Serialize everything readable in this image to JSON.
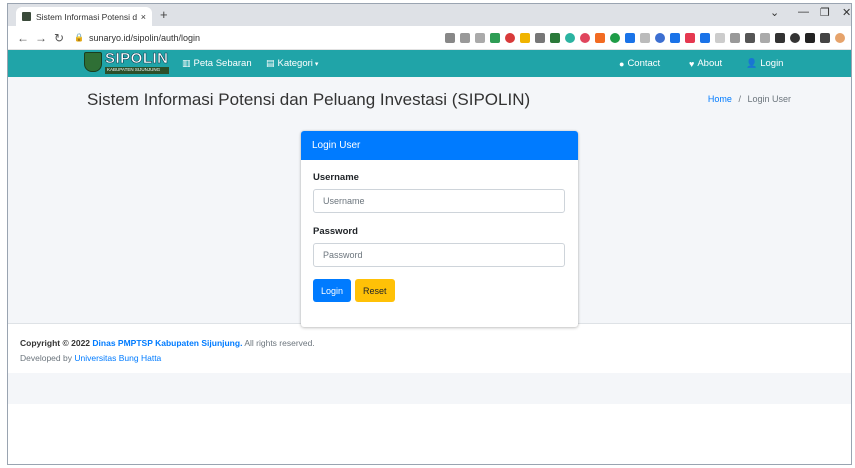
{
  "browser": {
    "tab_title": "Sistem Informasi Potensi dan Pel",
    "tab_close": "×",
    "new_tab": "+",
    "url": "sunaryo.id/sipolin/auth/login",
    "window_controls": {
      "minimize": "—",
      "maximize": "❐",
      "close": "✕",
      "dropdown": "⌄"
    }
  },
  "navbar": {
    "logo_text": "SIPOLIN",
    "logo_subtext": "KABUPATEN SIJUNJUNG",
    "links": [
      {
        "label": "Peta Sebaran",
        "icon": "map-icon"
      },
      {
        "label": "Kategori",
        "icon": "category-icon",
        "caret": "▾"
      }
    ],
    "right_links": [
      {
        "label": "Contact",
        "icon": "chat-icon"
      },
      {
        "label": "About",
        "icon": "heart-icon"
      },
      {
        "label": "Login",
        "icon": "user-icon"
      }
    ],
    "bg_color": "#20a4a8"
  },
  "page": {
    "title": "Sistem Informasi Potensi dan Peluang Investasi (SIPOLIN)",
    "breadcrumb": {
      "home": "Home",
      "separator": "/",
      "current": "Login User"
    }
  },
  "login_card": {
    "header": "Login User",
    "username_label": "Username",
    "username_placeholder": "Username",
    "password_label": "Password",
    "password_placeholder": "Password",
    "login_button": "Login",
    "reset_button": "Reset",
    "accent": "#007bff",
    "reset_color": "#ffc107"
  },
  "footer": {
    "copyright_prefix": "Copyright © 2022",
    "org": "Dinas PMPTSP Kabupaten Sijunjung.",
    "rights": "All rights reserved.",
    "developed_prefix": "Developed by",
    "developer": "Universitas Bung Hatta"
  }
}
